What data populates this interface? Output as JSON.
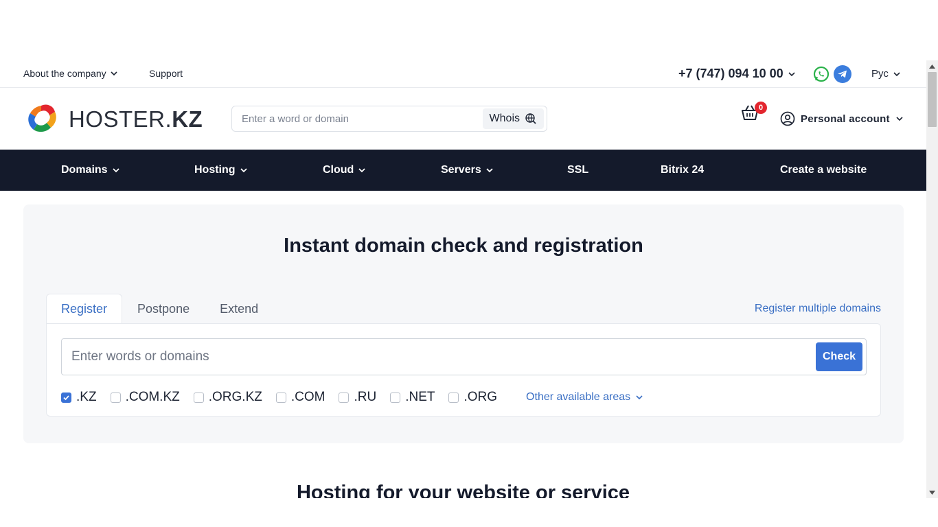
{
  "topbar": {
    "about_label": "About the company",
    "support_label": "Support",
    "phone": "+7 (747) 094 10 00",
    "whatsapp_icon": "whatsapp-icon",
    "telegram_icon": "telegram-icon",
    "language": "Рус"
  },
  "header": {
    "logo_text_light": "HOSTER.",
    "logo_text_bold": "KZ",
    "search_placeholder": "Enter a word or domain",
    "whois_label": "Whois",
    "cart_count": "0",
    "account_label": "Personal account"
  },
  "nav": {
    "items": [
      {
        "label": "Domains",
        "dropdown": true
      },
      {
        "label": "Hosting",
        "dropdown": true
      },
      {
        "label": "Cloud",
        "dropdown": true
      },
      {
        "label": "Servers",
        "dropdown": true
      },
      {
        "label": "SSL",
        "dropdown": false
      },
      {
        "label": "Bitrix 24",
        "dropdown": false
      },
      {
        "label": "Create a website",
        "dropdown": false
      }
    ]
  },
  "domain_check": {
    "title": "Instant domain check and registration",
    "tabs": [
      {
        "label": "Register",
        "active": true
      },
      {
        "label": "Postpone",
        "active": false
      },
      {
        "label": "Extend",
        "active": false
      }
    ],
    "multi_link": "Register multiple domains",
    "input_placeholder": "Enter words or domains",
    "check_label": "Check",
    "zones": [
      {
        "label": ".KZ",
        "checked": true
      },
      {
        "label": ".COM.KZ",
        "checked": false
      },
      {
        "label": ".ORG.KZ",
        "checked": false
      },
      {
        "label": ".COM",
        "checked": false
      },
      {
        "label": ".RU",
        "checked": false
      },
      {
        "label": ".NET",
        "checked": false
      },
      {
        "label": ".ORG",
        "checked": false
      }
    ],
    "other_areas_label": "Other available areas"
  },
  "hosting_section": {
    "title": "Hosting for your website or service"
  },
  "colors": {
    "nav_bg": "#141a2b",
    "accent": "#3a72d6",
    "link": "#3a6fc4",
    "badge": "#e3262e"
  }
}
